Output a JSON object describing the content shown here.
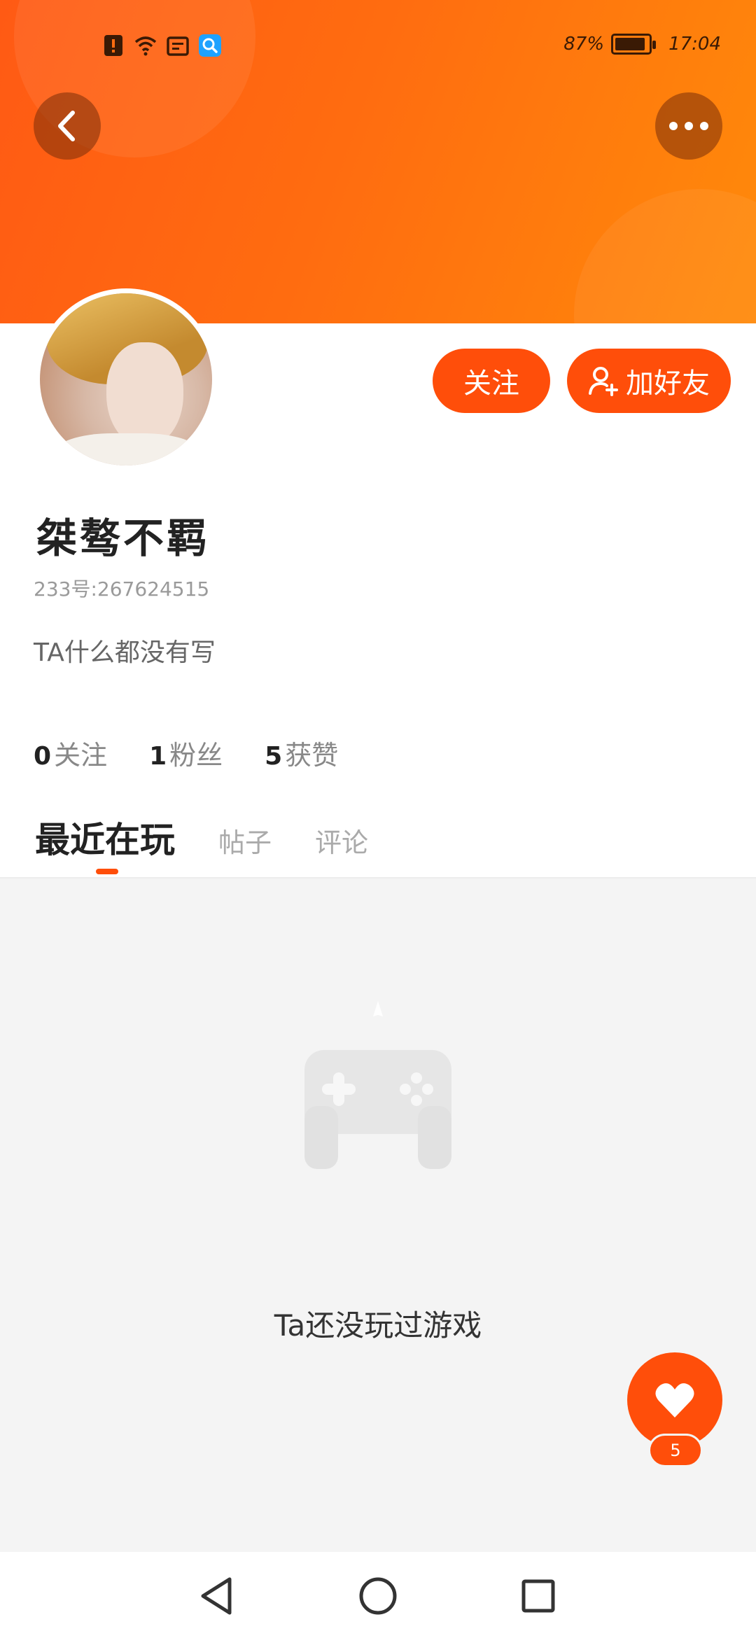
{
  "status_bar": {
    "battery": "87%",
    "time": "17:04",
    "icons": [
      "alert-icon",
      "wifi-icon",
      "message-icon",
      "search-app-icon"
    ]
  },
  "header": {
    "back_icon": "chevron-left-icon",
    "more_icon": "more-dots-icon",
    "banner_colors": [
      "#ff5a14",
      "#ff8a0a"
    ]
  },
  "actions": {
    "follow_label": "关注",
    "add_friend_label": "加好友"
  },
  "profile": {
    "name": "桀骜不羁",
    "uid_label": "233号:267624515",
    "bio": "TA什么都没有写"
  },
  "stats": [
    {
      "count": "0",
      "label": "关注"
    },
    {
      "count": "1",
      "label": "粉丝"
    },
    {
      "count": "5",
      "label": "获赞"
    }
  ],
  "tabs": [
    {
      "label": "最近在玩",
      "active": true
    },
    {
      "label": "帖子",
      "active": false
    },
    {
      "label": "评论",
      "active": false
    }
  ],
  "empty_state": {
    "message": "Ta还没玩过游戏",
    "icon": "gamepad-icon"
  },
  "like_fab": {
    "icon": "heart-icon",
    "count": "5"
  },
  "accent_color": "#ff4e0a"
}
